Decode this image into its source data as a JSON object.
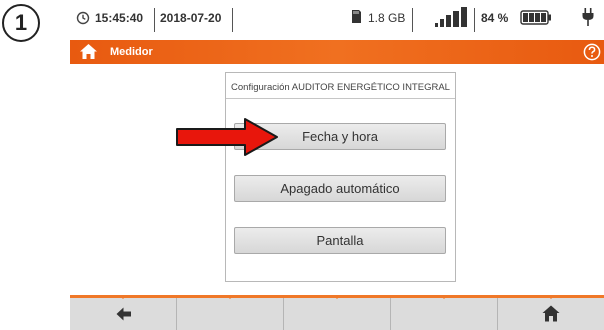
{
  "step_number": "1",
  "status": {
    "time": "15:45:40",
    "date": "2018-07-20",
    "storage": "1.8 GB",
    "battery": "84 %"
  },
  "titlebar": {
    "title": "Medidor"
  },
  "panel": {
    "title": "Configuración AUDITOR ENERGÉTICO INTEGRAL",
    "items": [
      {
        "label": "Fecha y hora"
      },
      {
        "label": "Apagado automático"
      },
      {
        "label": "Pantalla"
      }
    ]
  },
  "colors": {
    "accent": "#f07020",
    "callout_arrow": "#e8160c"
  },
  "icons": {
    "clock": "clock-icon",
    "sd_card": "sd-card-icon",
    "signal": "signal-bars-icon",
    "battery": "battery-icon",
    "plug": "power-plug-icon",
    "home": "home-icon",
    "help": "help-icon",
    "back": "back-arrow-icon"
  }
}
